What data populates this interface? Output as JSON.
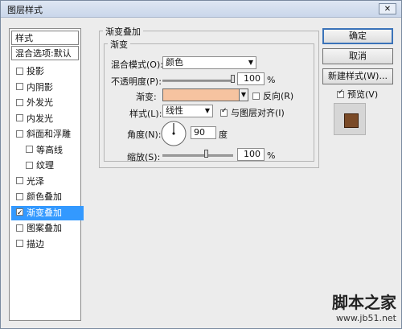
{
  "window": {
    "title": "图层样式"
  },
  "left": {
    "header1": "样式",
    "header2": "混合选项:默认",
    "items": [
      {
        "label": "投影",
        "checked": false,
        "indent": false,
        "selected": false
      },
      {
        "label": "内阴影",
        "checked": false,
        "indent": false,
        "selected": false
      },
      {
        "label": "外发光",
        "checked": false,
        "indent": false,
        "selected": false
      },
      {
        "label": "内发光",
        "checked": false,
        "indent": false,
        "selected": false
      },
      {
        "label": "斜面和浮雕",
        "checked": false,
        "indent": false,
        "selected": false
      },
      {
        "label": "等高线",
        "checked": false,
        "indent": true,
        "selected": false
      },
      {
        "label": "纹理",
        "checked": false,
        "indent": true,
        "selected": false
      },
      {
        "label": "光泽",
        "checked": false,
        "indent": false,
        "selected": false
      },
      {
        "label": "颜色叠加",
        "checked": false,
        "indent": false,
        "selected": false
      },
      {
        "label": "渐变叠加",
        "checked": true,
        "indent": false,
        "selected": true
      },
      {
        "label": "图案叠加",
        "checked": false,
        "indent": false,
        "selected": false
      },
      {
        "label": "描边",
        "checked": false,
        "indent": false,
        "selected": false
      }
    ]
  },
  "gradient_overlay": {
    "group_title": "渐变叠加",
    "sub_title": "渐变",
    "blend_mode_label": "混合模式(O):",
    "blend_mode_value": "颜色",
    "opacity_label": "不透明度(P):",
    "opacity_value": "100",
    "opacity_pct": 1.0,
    "opacity_unit": "%",
    "gradient_label": "渐变:",
    "gradient_color": "#f6c3a0",
    "reverse_label": "反向(R)",
    "style_label": "样式(L):",
    "style_value": "线性",
    "align_label": "与图层对齐(I)",
    "angle_label": "角度(N):",
    "angle_value": "90",
    "angle_unit": "度",
    "scale_label": "缩放(S):",
    "scale_value": "100",
    "scale_unit": "%"
  },
  "buttons": {
    "ok": "确定",
    "cancel": "取消",
    "new_style": "新建样式(W)...",
    "preview_label": "预览(V)"
  },
  "preview": {
    "color": "#7a4a27"
  },
  "watermark": {
    "top": "脚本之家",
    "bottom": "www.jb51.net"
  }
}
